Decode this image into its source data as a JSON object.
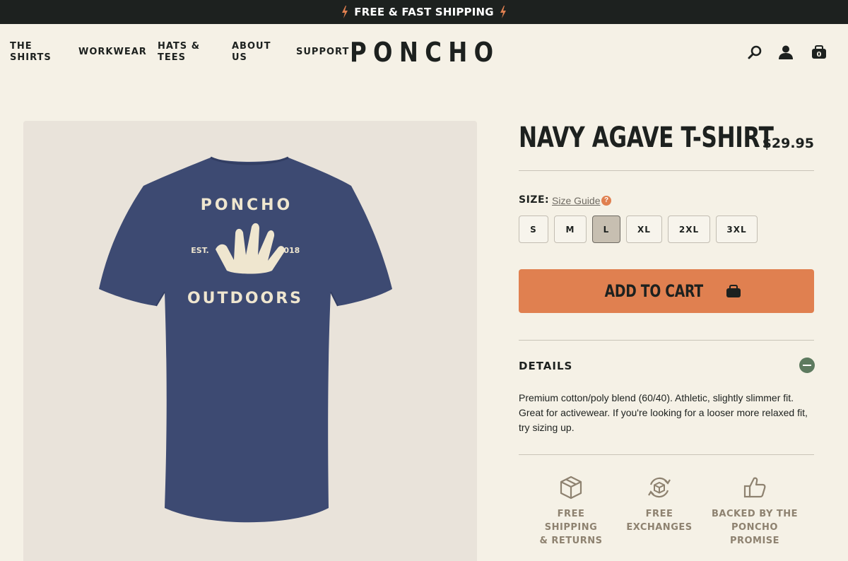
{
  "announcement": {
    "text": "FREE & FAST SHIPPING"
  },
  "nav": {
    "items": [
      {
        "label": "THE\nSHIRTS"
      },
      {
        "label": "WORKWEAR"
      },
      {
        "label": "HATS &\nTEES"
      },
      {
        "label": "ABOUT\nUS"
      },
      {
        "label": "SUPPORT"
      }
    ],
    "logo": "PONCHO",
    "cart_count": "0",
    "icons": [
      "search-icon",
      "account-icon",
      "cart-icon"
    ]
  },
  "product": {
    "title": "NAVY AGAVE T-SHIRT",
    "price": "$29.95",
    "image": {
      "shirt_color": "#3d4a72",
      "print_color": "#efe6cf",
      "print_top": "PONCHO",
      "print_bottom": "OUTDOORS",
      "print_left": "EST.",
      "print_right": "2018"
    },
    "size_label": "SIZE:",
    "size_guide": "Size Guide",
    "sizes": [
      "S",
      "M",
      "L",
      "XL",
      "2XL",
      "3XL"
    ],
    "selected_size": "L",
    "add_to_cart": "ADD TO CART",
    "details": {
      "heading": "DETAILS",
      "text": "Premium cotton/poly blend (60/40). Athletic, slightly slimmer fit. Great for activewear. If you're looking for a looser more relaxed fit, try sizing up."
    },
    "perks": [
      {
        "label": "FREE SHIPPING\n& RETURNS",
        "icon": "box-icon"
      },
      {
        "label": "FREE\nEXCHANGES",
        "icon": "exchange-icon"
      },
      {
        "label": "BACKED BY THE\nPONCHO PROMISE",
        "icon": "thumbs-up-icon"
      }
    ]
  },
  "colors": {
    "accent": "#e08050",
    "dark": "#1d211f",
    "background": "#f5f1e6",
    "perk_text": "#8e8270",
    "collapse": "#5d7a5f"
  }
}
